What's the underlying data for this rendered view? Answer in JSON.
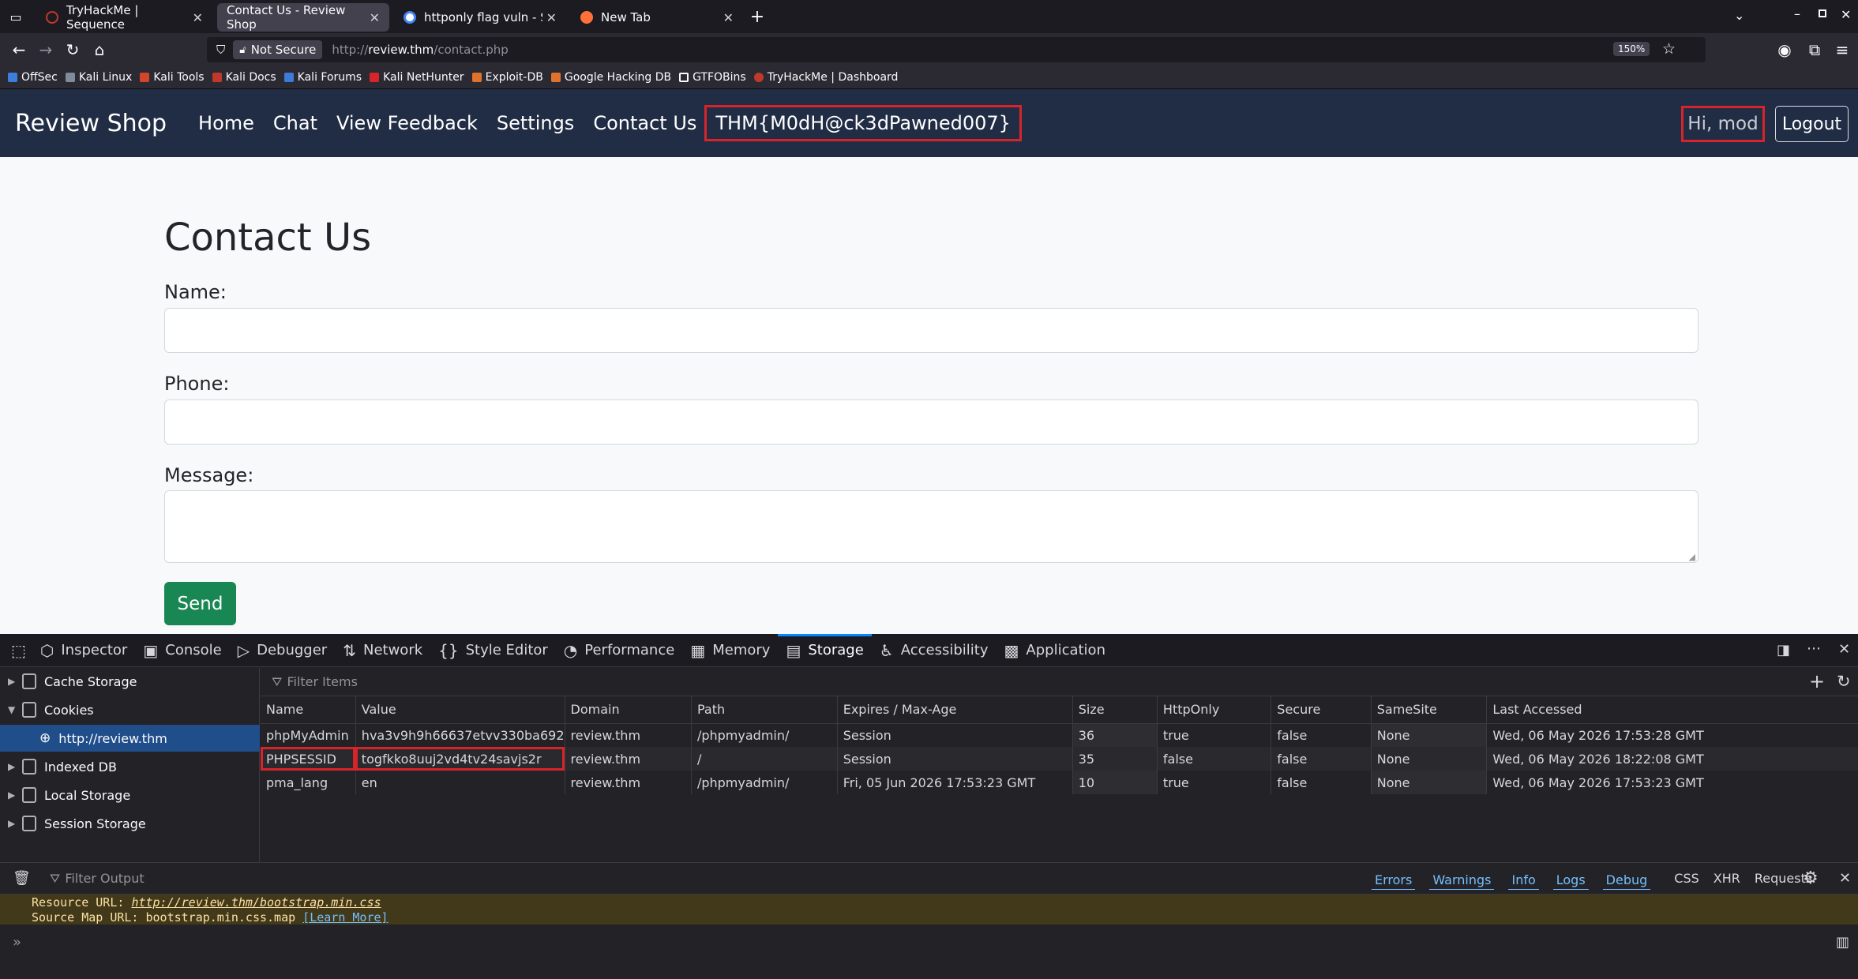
{
  "browser": {
    "tabs": [
      {
        "label": "TryHackMe | Sequence",
        "favicon_color": "#c0392b"
      },
      {
        "label": "Contact Us - Review Shop",
        "favicon_color": ""
      },
      {
        "label": "httponly flag vuln - Sök på",
        "favicon_color": "#4285f4"
      },
      {
        "label": "New Tab",
        "favicon_color": "#ff7139"
      }
    ],
    "security_label": "Not Secure",
    "url_prefix": "http://",
    "url_host": "review.thm",
    "url_path": "/contact.php",
    "zoom": "150%",
    "bookmarks": [
      "OffSec",
      "Kali Linux",
      "Kali Tools",
      "Kali Docs",
      "Kali Forums",
      "Kali NetHunter",
      "Exploit-DB",
      "Google Hacking DB",
      "GTFOBins",
      "TryHackMe | Dashboard"
    ]
  },
  "site": {
    "brand": "Review Shop",
    "nav": [
      "Home",
      "Chat",
      "View Feedback",
      "Settings",
      "Contact Us"
    ],
    "flag": "THM{M0dH@ck3dPawned007}",
    "greeting": "Hi, mod",
    "logout": "Logout",
    "heading": "Contact Us",
    "name_label": "Name:",
    "phone_label": "Phone:",
    "message_label": "Message:",
    "send": "Send"
  },
  "devtools": {
    "tabs": [
      "Inspector",
      "Console",
      "Debugger",
      "Network",
      "Style Editor",
      "Performance",
      "Memory",
      "Storage",
      "Accessibility",
      "Application"
    ],
    "active_tab": "Storage",
    "sidebar": [
      "Cache Storage",
      "Cookies",
      "http://review.thm",
      "Indexed DB",
      "Local Storage",
      "Session Storage"
    ],
    "filter_placeholder": "Filter Items",
    "columns": [
      "Name",
      "Value",
      "Domain",
      "Path",
      "Expires / Max-Age",
      "Size",
      "HttpOnly",
      "Secure",
      "SameSite",
      "Last Accessed"
    ],
    "cookies": [
      {
        "name": "phpMyAdmin",
        "value": "hva3v9h9h66637etvv330ba692",
        "domain": "review.thm",
        "path": "/phpmyadmin/",
        "expires": "Session",
        "size": "36",
        "httponly": "true",
        "secure": "false",
        "samesite": "None",
        "last": "Wed, 06 May 2026 17:53:28 GMT"
      },
      {
        "name": "PHPSESSID",
        "value": "togfkko8uuj2vd4tv24savjs2r",
        "domain": "review.thm",
        "path": "/",
        "expires": "Session",
        "size": "35",
        "httponly": "false",
        "secure": "false",
        "samesite": "None",
        "last": "Wed, 06 May 2026 18:22:08 GMT"
      },
      {
        "name": "pma_lang",
        "value": "en",
        "domain": "review.thm",
        "path": "/phpmyadmin/",
        "expires": "Fri, 05 Jun 2026 17:53:23 GMT",
        "size": "10",
        "httponly": "true",
        "secure": "false",
        "samesite": "None",
        "last": "Wed, 06 May 2026 17:53:23 GMT"
      }
    ],
    "console": {
      "filter_placeholder": "Filter Output",
      "levels": [
        "Errors",
        "Warnings",
        "Info",
        "Logs",
        "Debug"
      ],
      "types": [
        "CSS",
        "XHR",
        "Requests"
      ],
      "line1_prefix": "Resource URL: ",
      "line1_url": "http://review.thm/bootstrap.min.css",
      "line2_prefix": "Source Map URL: bootstrap.min.css.map ",
      "line2_link": "[Learn More]"
    }
  },
  "colors": {
    "highlight": "#d6242a",
    "navbar": "#212d45",
    "send": "#198754"
  }
}
